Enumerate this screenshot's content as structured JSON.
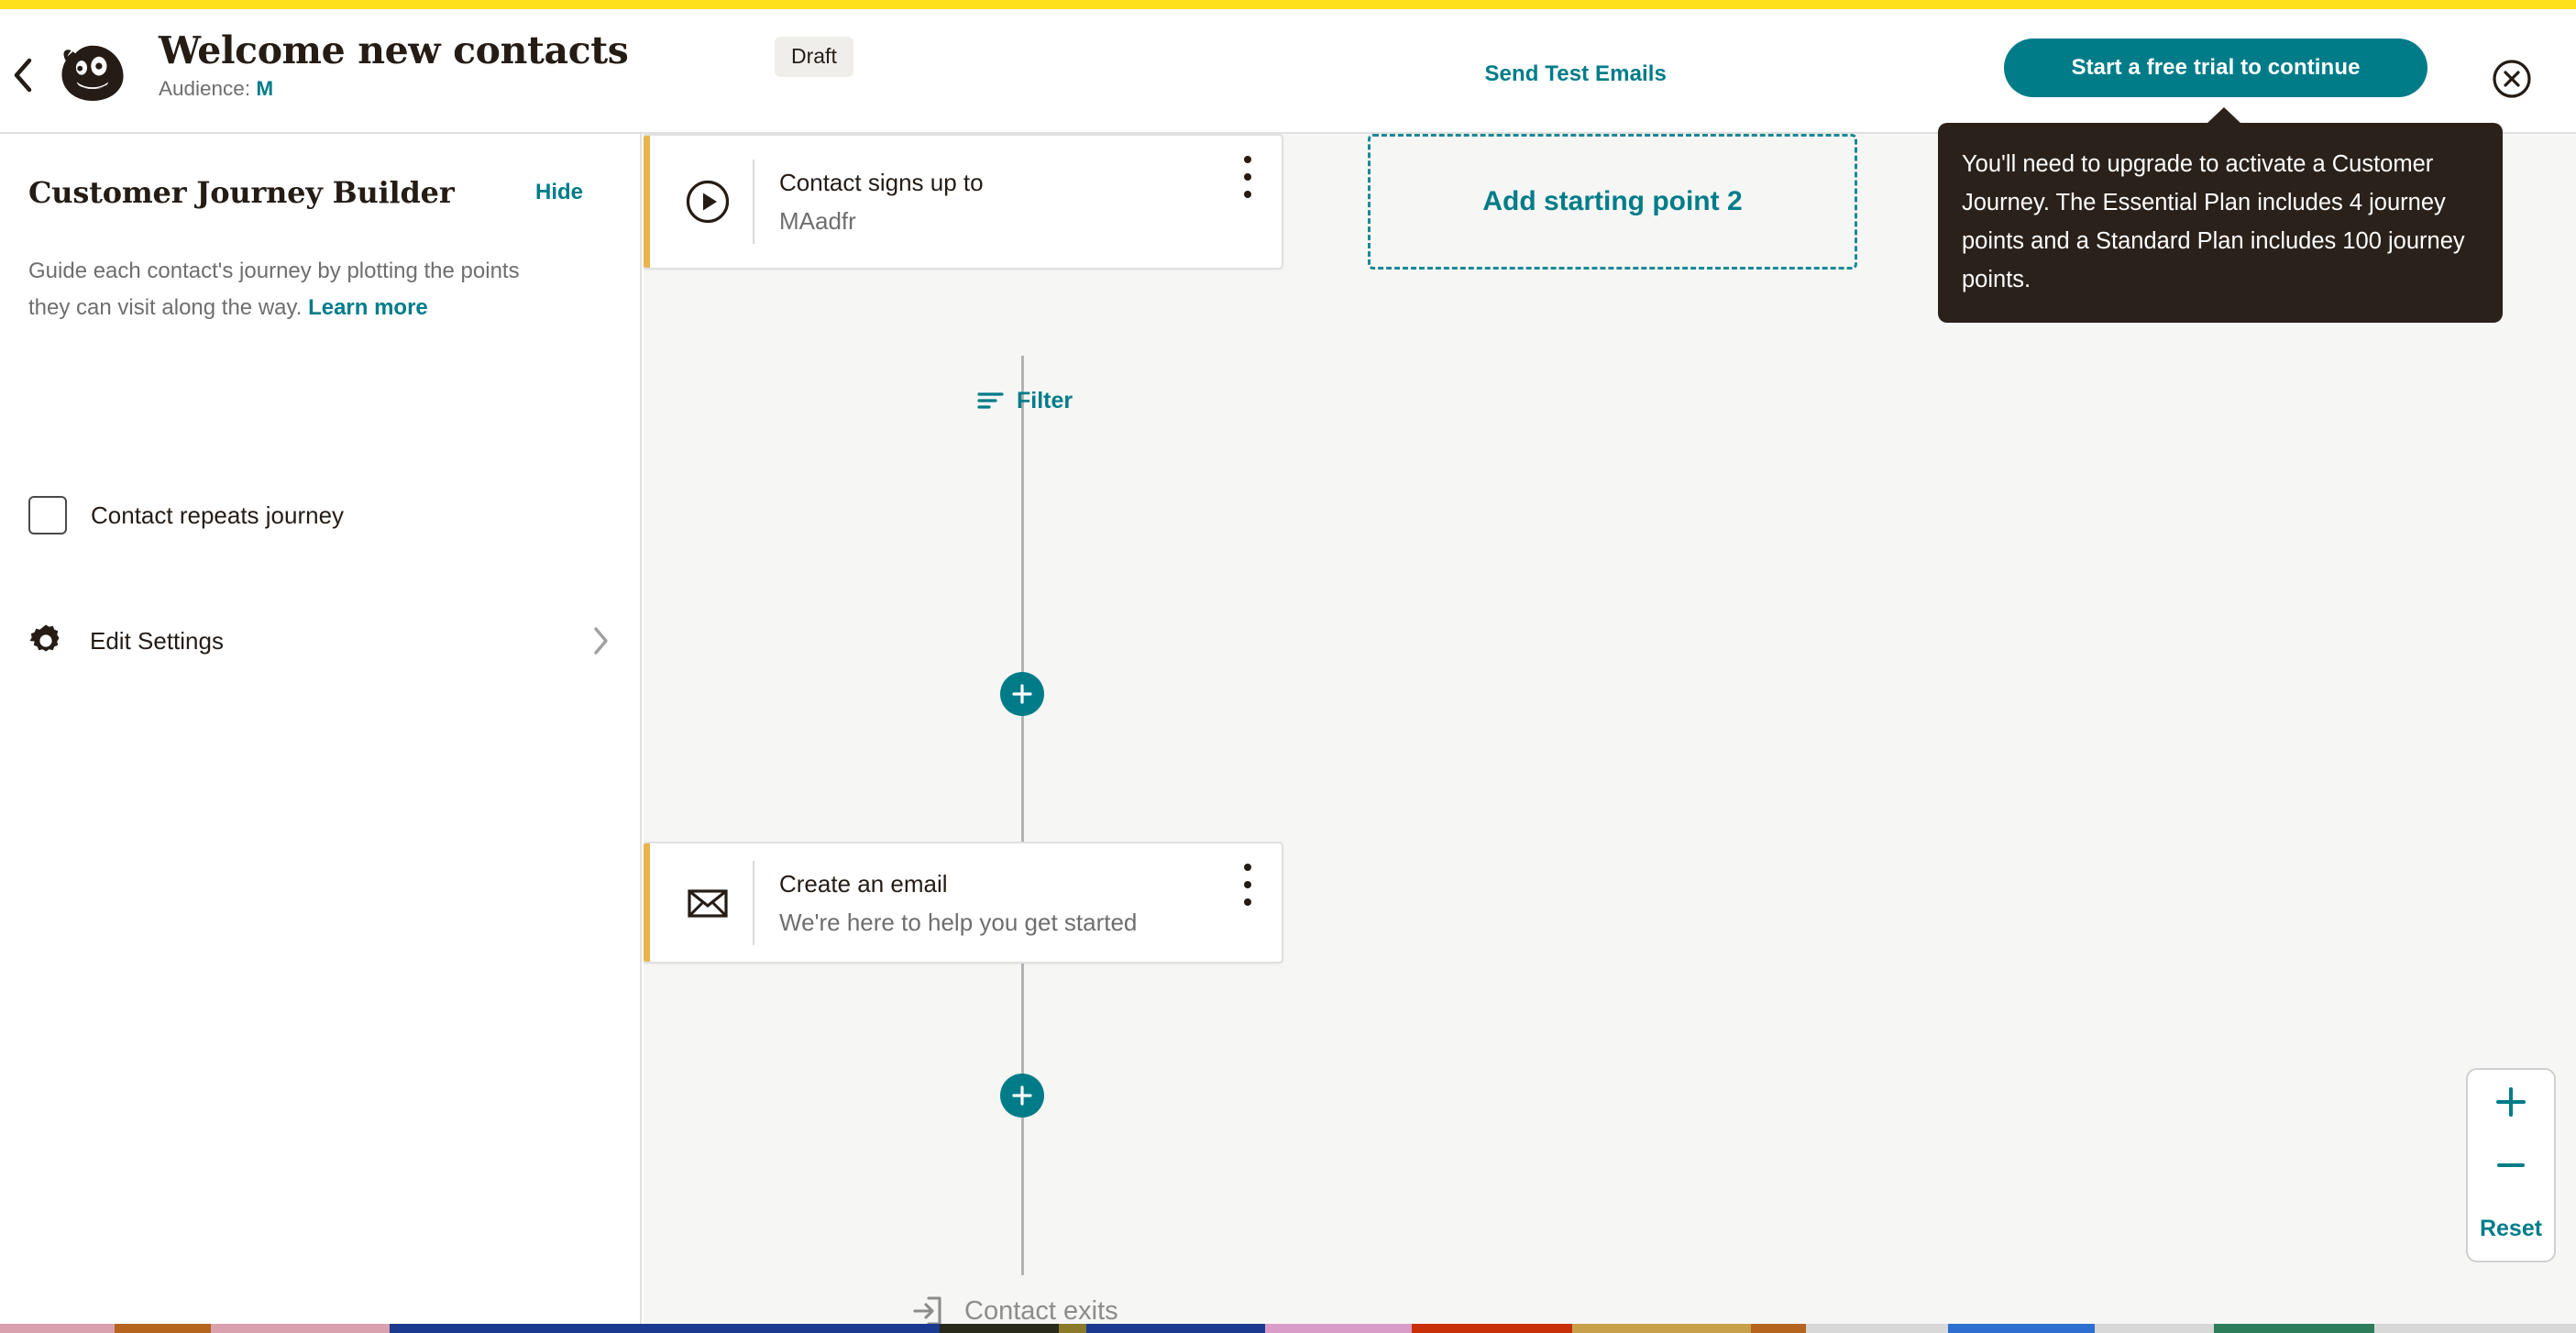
{
  "colors": {
    "brand_yellow": "#FFE01B",
    "teal": "#007C89",
    "node_accent": "#E9B44C",
    "canvas_bg": "#F6F6F4",
    "tooltip_bg": "#2A211A",
    "muted_text": "#6E6E6E"
  },
  "header": {
    "back_icon": "chevron-left-icon",
    "logo_icon": "mailchimp-freddie-logo",
    "title": "Welcome new contacts",
    "audience_label": "Audience:",
    "audience_name": "M",
    "status_badge": "Draft",
    "send_test_label": "Send Test Emails",
    "trial_button_label": "Start a free trial to continue",
    "close_icon": "close-circle-icon"
  },
  "tooltip": {
    "text": "You'll need to upgrade to activate a Customer Journey. The Essential Plan includes 4 journey points and a Standard Plan includes 100 journey points."
  },
  "sidebar": {
    "title": "Customer Journey Builder",
    "hide_label": "Hide",
    "description": "Guide each contact's journey by plotting the points they can visit along the way.",
    "learn_more_label": "Learn more",
    "repeat_checkbox_label": "Contact repeats journey",
    "repeat_checkbox_checked": false,
    "edit_settings_label": "Edit Settings",
    "edit_settings_icon": "gear-icon",
    "edit_settings_chevron": "chevron-right-icon"
  },
  "canvas": {
    "starting_point": {
      "icon": "play-circle-icon",
      "title": "Contact signs up to",
      "subtitle": "MAadfr",
      "menu_icon": "kebab-menu-icon"
    },
    "filter": {
      "icon": "filter-icon",
      "label": "Filter"
    },
    "add_starting_point_label": "Add starting point 2",
    "email_node": {
      "icon": "envelope-icon",
      "title": "Create an email",
      "subtitle": "We're here to help you get started",
      "menu_icon": "kebab-menu-icon"
    },
    "add_step_label": "+",
    "exits": {
      "icon": "exit-arrow-icon",
      "label": "Contact exits"
    }
  },
  "zoom_control": {
    "zoom_in_icon": "plus-icon",
    "zoom_out_icon": "minus-icon",
    "reset_label": "Reset"
  }
}
